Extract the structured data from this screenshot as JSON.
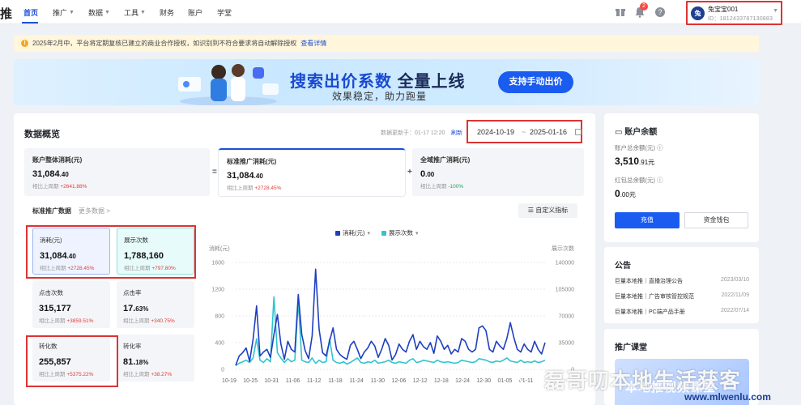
{
  "nav": {
    "logo_fragment": "推",
    "items": [
      {
        "label": "首页",
        "active": true,
        "caret": false
      },
      {
        "label": "推广",
        "active": false,
        "caret": true
      },
      {
        "label": "数据",
        "active": false,
        "caret": true
      },
      {
        "label": "工具",
        "active": false,
        "caret": true
      },
      {
        "label": "财务",
        "active": false,
        "caret": false
      },
      {
        "label": "账户",
        "active": false,
        "caret": false
      },
      {
        "label": "学堂",
        "active": false,
        "caret": false
      }
    ],
    "notification_count": "2",
    "account": {
      "avatar_text": "兔",
      "name": "兔宝宝001",
      "id_text": "ID：1812433787130883"
    },
    "icons": [
      "gift-icon",
      "bell-icon",
      "help-icon",
      "chevron-down-icon"
    ]
  },
  "notice": {
    "text": "2025年2月中，平台将定期复核已建立的商业合作授权，如识别到不符合要求将自动解除授权",
    "link": "查看详情"
  },
  "banner": {
    "title_a": "搜索出价系数",
    "title_b": "全量上线",
    "subtitle": "效果稳定，助力跑量",
    "button": "支持手动出价"
  },
  "overview": {
    "title": "数据概览",
    "updated": "数据更新于：01-17 12:20",
    "refresh": "刷新",
    "date_start": "2024-10-19",
    "date_sep": "~",
    "date_end": "2025-01-16",
    "tabs": [
      {
        "title": "账户整体消耗(元)",
        "value": "31,084",
        "decimals": ".40",
        "compare_label": "相比上周期",
        "compare": "+2641.88%",
        "trend": "up",
        "selected": false
      },
      {
        "title": "标准推广消耗(元)",
        "value": "31,084",
        "decimals": ".40",
        "compare_label": "相比上周期",
        "compare": "+2728.45%",
        "trend": "up",
        "selected": true
      },
      {
        "title": "全域推广消耗(元)",
        "value": "0",
        "decimals": ".00",
        "compare_label": "相比上周期",
        "compare": "-100%",
        "trend": "down",
        "selected": false
      }
    ],
    "operators": [
      "=",
      "+"
    ],
    "sub_title": "标准推广数据",
    "sub_more": "更多数据 >",
    "custom_button": "自定义指标",
    "kpis": [
      {
        "title": "消耗(元)",
        "value": "31,084",
        "decimals": ".40",
        "compare_label": "相比上周期",
        "compare": "+2728.45%"
      },
      {
        "title": "展示次数",
        "value": "1,788,160",
        "decimals": "",
        "compare_label": "相比上周期",
        "compare": "+797.80%"
      },
      {
        "title": "点击次数",
        "value": "315,177",
        "decimals": "",
        "compare_label": "相比上周期",
        "compare": "+3859.51%"
      },
      {
        "title": "点击率",
        "value": "17.",
        "decimals": "63%",
        "compare_label": "相比上周期",
        "compare": "+340.75%"
      },
      {
        "title": "转化数",
        "value": "255,857",
        "decimals": "",
        "compare_label": "相比上周期",
        "compare": "+5375.22%"
      },
      {
        "title": "转化率",
        "value": "81.",
        "decimals": "18%",
        "compare_label": "相比上周期",
        "compare": "+38.27%"
      }
    ]
  },
  "chart_data": {
    "type": "line",
    "left_axis_label": "消耗(元)",
    "right_axis_label": "展示次数",
    "left_ticks": [
      "0",
      "400",
      "800",
      "1200",
      "1600"
    ],
    "right_ticks": [
      "0",
      "35000",
      "70000",
      "105000",
      "140000"
    ],
    "left_lim": [
      0,
      1600
    ],
    "right_lim": [
      0,
      140000
    ],
    "x_ticks": [
      "10-19",
      "10-25",
      "10-31",
      "11-06",
      "11-12",
      "11-18",
      "11-24",
      "11-30",
      "12-06",
      "12-12",
      "12-18",
      "12-24",
      "12-30",
      "01-05",
      "01-11"
    ],
    "grid": true,
    "series": [
      {
        "name": "消耗(元)",
        "color": "#1f3fbf",
        "axis": "left",
        "values": [
          60,
          200,
          250,
          320,
          120,
          450,
          950,
          200,
          260,
          300,
          180,
          520,
          820,
          380,
          150,
          420,
          300,
          260,
          1120,
          520,
          280,
          160,
          500,
          1500,
          600,
          250,
          200,
          420,
          620,
          300,
          220,
          180,
          150,
          360,
          420,
          300,
          160,
          260,
          320,
          420,
          350,
          180,
          300,
          460,
          360,
          140,
          220,
          380,
          300,
          260,
          420,
          520,
          300,
          420,
          340,
          300,
          400,
          240,
          500,
          420,
          300,
          360,
          230,
          300,
          260,
          460,
          420,
          300,
          260,
          300,
          620,
          650,
          580,
          300,
          260,
          420,
          350,
          300,
          460,
          700,
          480,
          300,
          260,
          380,
          300,
          260,
          420,
          300,
          230,
          400
        ]
      },
      {
        "name": "展示次数",
        "color": "#2ec4cf",
        "axis": "right",
        "values": [
          5000,
          8000,
          10000,
          12000,
          9000,
          15000,
          40000,
          12000,
          9000,
          14000,
          10000,
          95000,
          22000,
          15000,
          9000,
          14000,
          10000,
          12000,
          90000,
          12000,
          10000,
          9000,
          15000,
          8000,
          12000,
          9000,
          10000,
          40000,
          12000,
          9000,
          8000,
          10000,
          7000,
          9000,
          12000,
          15000,
          9000,
          8000,
          10000,
          9000,
          12000,
          8000,
          9000,
          10000,
          12000,
          9000,
          8000,
          10000,
          9000,
          8000,
          12000,
          14000,
          9000,
          10000,
          12000,
          11000,
          10000,
          9000,
          12000,
          10000,
          9000,
          10000,
          9000,
          8000,
          9000,
          12000,
          11000,
          10000,
          9000,
          10000,
          14000,
          13000,
          12000,
          10000,
          9000,
          11000,
          10000,
          12000,
          15000,
          11000,
          10000,
          9000,
          12000,
          9000,
          10000,
          9000,
          11000,
          9000,
          10000,
          12000
        ]
      }
    ]
  },
  "balance": {
    "title": "账户余额",
    "total_label": "账户总余额(元)",
    "total_value": "3,510",
    "total_decimals": ".91",
    "total_unit": "元",
    "red_label": "红包总余额(元)",
    "red_value": "0",
    "red_decimals": ".00",
    "red_unit": "元",
    "recharge": "充值",
    "wallet": "资金钱包"
  },
  "announcements": {
    "title": "公告",
    "items": [
      {
        "text": "巨量本地推｜直播治理公告",
        "date": "2023/03/10"
      },
      {
        "text": "巨量本地推｜广告审核管控规范",
        "date": "2022/11/09"
      },
      {
        "text": "巨量本地推｜PC端产品手册",
        "date": "2022/07/14"
      }
    ]
  },
  "course": {
    "title": "推广课堂",
    "image_text": "本地推视频课堂"
  },
  "watermark": {
    "text": "磊哥叨本地生活获客",
    "url": "www.mlwenlu.com"
  }
}
